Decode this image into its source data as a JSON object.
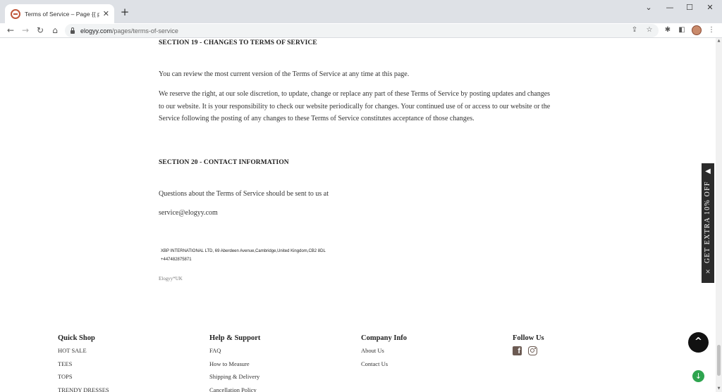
{
  "browser": {
    "tab_title": "Terms of Service – Page {{ page }}",
    "tab_close": "✕",
    "new_tab": "+",
    "url_domain": "elogyy.com",
    "url_path": "/pages/terms-of-service",
    "window_controls": {
      "minimize": "—",
      "maximize": "☐",
      "close": "✕",
      "dropdown": "⌄"
    }
  },
  "content": {
    "section19": {
      "heading": "SECTION 19 - CHANGES TO TERMS OF SERVICE",
      "para1": "You can review the most current version of the Terms of Service at any time at this page.",
      "para2": "We reserve the right, at our sole discretion, to update, change or replace any part of these Terms of Service by posting updates and changes to our website. It is your responsibility to check our website periodically for changes. Your continued use of or access to our website or the Service following the posting of any changes to these Terms of Service constitutes acceptance of those changes."
    },
    "section20": {
      "heading": "SECTION 20 - CONTACT INFORMATION",
      "para1": "Questions about the Terms of Service should be sent to us at",
      "email": "service@elogyy.com"
    },
    "address_line1": "XBP INTERNATIONAL LTD, 69 Aberdeen Avenue,Cambridge,United Kingdom,CB2 8DL",
    "address_line2": "+447482875871",
    "brand": "Elogyy*UK"
  },
  "footer": {
    "quick_shop": {
      "heading": "Quick Shop",
      "links": [
        "HOT SALE",
        "TEES",
        "TOPS",
        "TRENDY DRESSES"
      ]
    },
    "help_support": {
      "heading": "Help & Support",
      "links": [
        "FAQ",
        "How to Measure",
        "Shipping & Delivery",
        "Cancellation Policy"
      ]
    },
    "company_info": {
      "heading": "Company Info",
      "links": [
        "About Us",
        "Contact Us"
      ]
    },
    "follow_us": {
      "heading": "Follow Us",
      "icons": [
        "facebook-icon",
        "instagram-icon"
      ]
    }
  },
  "widgets": {
    "promo_text": "GET EXTRA 10% OFF",
    "promo_arrow": "◀",
    "promo_close": "✕",
    "back_to_top": "^",
    "download_glyph": "↓"
  }
}
